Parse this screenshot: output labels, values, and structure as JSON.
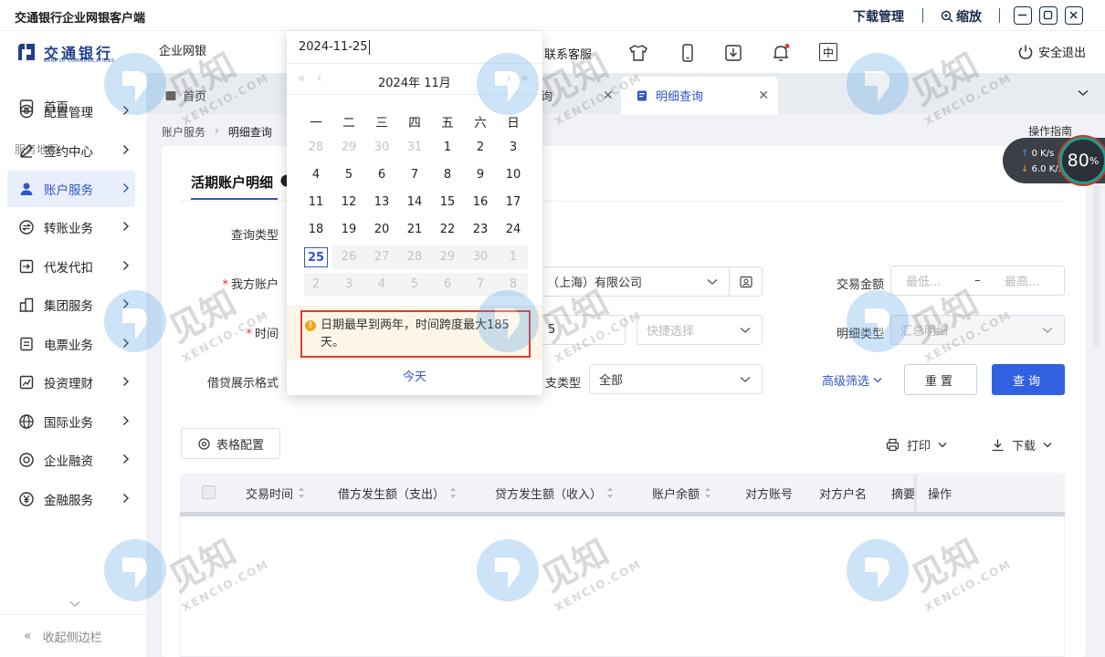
{
  "window": {
    "title": "交通银行企业网银客户端",
    "download_label": "下载管理",
    "zoom_label": "缩放"
  },
  "header": {
    "logo_cn": "交通银行",
    "logo_en": "BANK OF COMMUNICATIONS",
    "product": "企业网银",
    "service_link": "联系客服",
    "logout": "安全退出",
    "lang_icon_text": "中"
  },
  "sidebar": {
    "home": "首页",
    "section_label": "服务地图",
    "items": [
      {
        "label": "配置管理",
        "icon": "gear-icon"
      },
      {
        "label": "签约中心",
        "icon": "pen-icon"
      },
      {
        "label": "账户服务",
        "icon": "user-icon",
        "active": true
      },
      {
        "label": "转账业务",
        "icon": "transfer-icon"
      },
      {
        "label": "代发代扣",
        "icon": "payroll-icon"
      },
      {
        "label": "集团服务",
        "icon": "building-icon"
      },
      {
        "label": "电票业务",
        "icon": "bill-icon"
      },
      {
        "label": "投资理财",
        "icon": "chart-icon"
      },
      {
        "label": "国际业务",
        "icon": "globe-icon"
      },
      {
        "label": "企业融资",
        "icon": "finance-icon"
      },
      {
        "label": "金融服务",
        "icon": "yen-icon"
      }
    ],
    "collapse": "收起侧边栏"
  },
  "tabs": [
    {
      "label": "首页"
    },
    {
      "label": "询"
    },
    {
      "label": "明细查询",
      "active": true
    }
  ],
  "breadcrumb": {
    "parent": "账户服务",
    "current": "明细查询"
  },
  "guide": "操作指南",
  "panel": {
    "title": "活期账户明细"
  },
  "form": {
    "query_type_label": "查询类型",
    "account_label": "我方账户",
    "account_value": "（上海）有限公司",
    "time_label": "时间",
    "time_end_fragment": "5",
    "quick_select_placeholder": "快捷选择",
    "debit_format_label": "借贷展示格式",
    "inout_type_label": "支类型",
    "inout_type_value": "全部",
    "amount_label": "交易金额",
    "amount_min_placeholder": "最低...",
    "amount_max_placeholder": "最高...",
    "detail_type_label": "明细类型",
    "detail_type_value": "汇总明细",
    "advanced_filter": "高级筛选",
    "reset": "重置",
    "query": "查询"
  },
  "toolbar": {
    "table_config": "表格配置",
    "print": "打印",
    "download": "下载"
  },
  "table": {
    "columns": [
      "交易时间",
      "借方发生额（支出）",
      "贷方发生额（收入）",
      "账户余额",
      "对方账号",
      "对方户名",
      "摘要",
      "操作"
    ]
  },
  "speed_widget": {
    "up": "0 K/s",
    "down": "6.0 K/s",
    "percent": "80",
    "pct_unit": "%"
  },
  "datepicker": {
    "input_value": "2024-11-25",
    "month_label": "2024年 11月",
    "weekdays": [
      "一",
      "二",
      "三",
      "四",
      "五",
      "六",
      "日"
    ],
    "weeks": [
      [
        "28",
        "29",
        "30",
        "31",
        "1",
        "2",
        "3"
      ],
      [
        "4",
        "5",
        "6",
        "7",
        "8",
        "9",
        "10"
      ],
      [
        "11",
        "12",
        "13",
        "14",
        "15",
        "16",
        "17"
      ],
      [
        "18",
        "19",
        "20",
        "21",
        "22",
        "23",
        "24"
      ],
      [
        "25",
        "26",
        "27",
        "28",
        "29",
        "30",
        "1"
      ],
      [
        "2",
        "3",
        "4",
        "5",
        "6",
        "7",
        "8"
      ]
    ],
    "warning": "日期最早到两年，时间跨度最大185天。",
    "today_label": "今天"
  },
  "watermark": {
    "text_cn": "见知",
    "text_en": "XENCIO.COM"
  },
  "colors": {
    "accent": "#3156c7",
    "primary_button": "#3161e0",
    "warning_bg": "#fdf6e6",
    "warning_border": "#dd3b34",
    "required": "#e0312b"
  }
}
